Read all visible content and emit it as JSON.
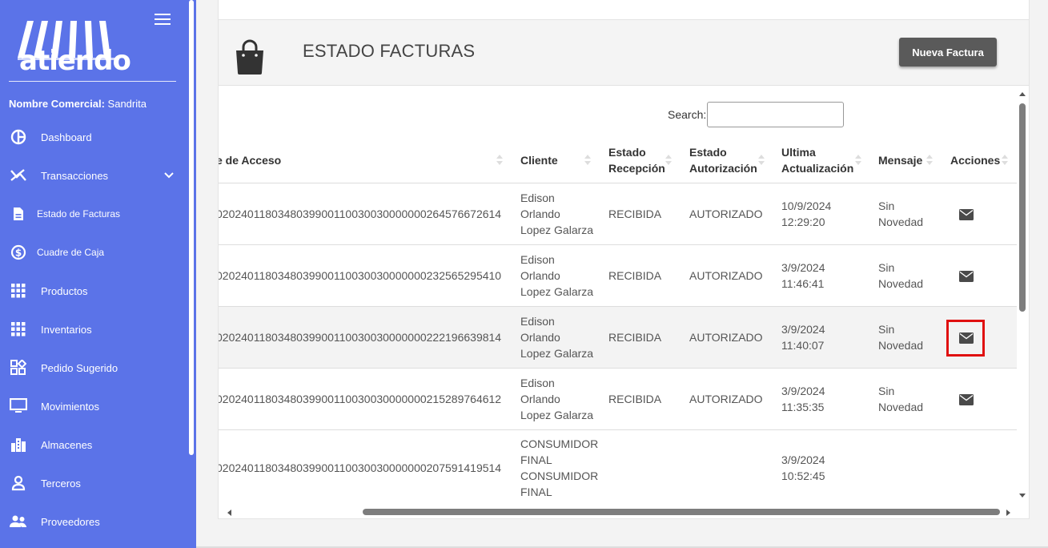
{
  "sidebar": {
    "logo_text": "atiendo",
    "store_label": "Nombre Comercial:",
    "store_value": "Sandrita",
    "items": [
      {
        "label": "Dashboard",
        "icon": "pie-chart-icon"
      },
      {
        "label": "Transacciones",
        "icon": "transactions-icon",
        "expandable": true
      },
      {
        "label": "Estado de Facturas",
        "icon": "document-icon"
      },
      {
        "label": "Cuadre de Caja",
        "icon": "dollar-circle-icon"
      },
      {
        "label": "Productos",
        "icon": "grid-icon"
      },
      {
        "label": "Inventarios",
        "icon": "grid-icon"
      },
      {
        "label": "Pedido Sugerido",
        "icon": "shapes-icon"
      },
      {
        "label": "Movimientos",
        "icon": "monitor-icon"
      },
      {
        "label": "Almacenes",
        "icon": "building-icon"
      },
      {
        "label": "Terceros",
        "icon": "person-icon"
      },
      {
        "label": "Proveedores",
        "icon": "people-icon"
      }
    ]
  },
  "panel": {
    "title": "ESTADO FACTURAS",
    "new_button": "Nueva Factura",
    "search_label": "Search:",
    "search_value": ""
  },
  "table": {
    "headers": {
      "clave": "e de Acceso",
      "cliente": "Cliente",
      "estado_recepcion_1": "Estado",
      "estado_recepcion_2": "Recepción",
      "estado_autorizacion_1": "Estado",
      "estado_autorizacion_2": "Autorización",
      "ultima_1": "Ultima",
      "ultima_2": "Actualización",
      "mensaje": "Mensaje",
      "acciones": "Acciones"
    },
    "rows": [
      {
        "clave": "0202401180348039900110030030000000264576672614",
        "cliente_1": "Edison",
        "cliente_2": "Orlando",
        "cliente_3": "Lopez Galarza",
        "recepcion": "RECIBIDA",
        "autorizacion": "AUTORIZADO",
        "fecha": "10/9/2024",
        "hora": "12:29:20",
        "mensaje_1": "Sin",
        "mensaje_2": "Novedad"
      },
      {
        "clave": "0202401180348039900110030030000000232565295410",
        "cliente_1": "Edison",
        "cliente_2": "Orlando",
        "cliente_3": "Lopez Galarza",
        "recepcion": "RECIBIDA",
        "autorizacion": "AUTORIZADO",
        "fecha": "3/9/2024",
        "hora": "11:46:41",
        "mensaje_1": "Sin",
        "mensaje_2": "Novedad"
      },
      {
        "clave": "0202401180348039900110030030000000222196639814",
        "cliente_1": "Edison",
        "cliente_2": "Orlando",
        "cliente_3": "Lopez Galarza",
        "recepcion": "RECIBIDA",
        "autorizacion": "AUTORIZADO",
        "fecha": "3/9/2024",
        "hora": "11:40:07",
        "mensaje_1": "Sin",
        "mensaje_2": "Novedad"
      },
      {
        "clave": "0202401180348039900110030030000000215289764612",
        "cliente_1": "Edison",
        "cliente_2": "Orlando",
        "cliente_3": "Lopez Galarza",
        "recepcion": "RECIBIDA",
        "autorizacion": "AUTORIZADO",
        "fecha": "3/9/2024",
        "hora": "11:35:35",
        "mensaje_1": "Sin",
        "mensaje_2": "Novedad"
      },
      {
        "clave": "0202401180348039900110030030000000207591419514",
        "cliente_1": "CONSUMIDOR",
        "cliente_2": "FINAL",
        "cliente_3": "CONSUMIDOR",
        "cliente_4": "FINAL",
        "recepcion": "",
        "autorizacion": "",
        "fecha": "3/9/2024",
        "hora": "10:52:45",
        "mensaje_1": "",
        "mensaje_2": ""
      }
    ]
  },
  "colors": {
    "sidebar": "#5b73e8",
    "highlight": "#e01010",
    "button": "#5a5a5a"
  }
}
